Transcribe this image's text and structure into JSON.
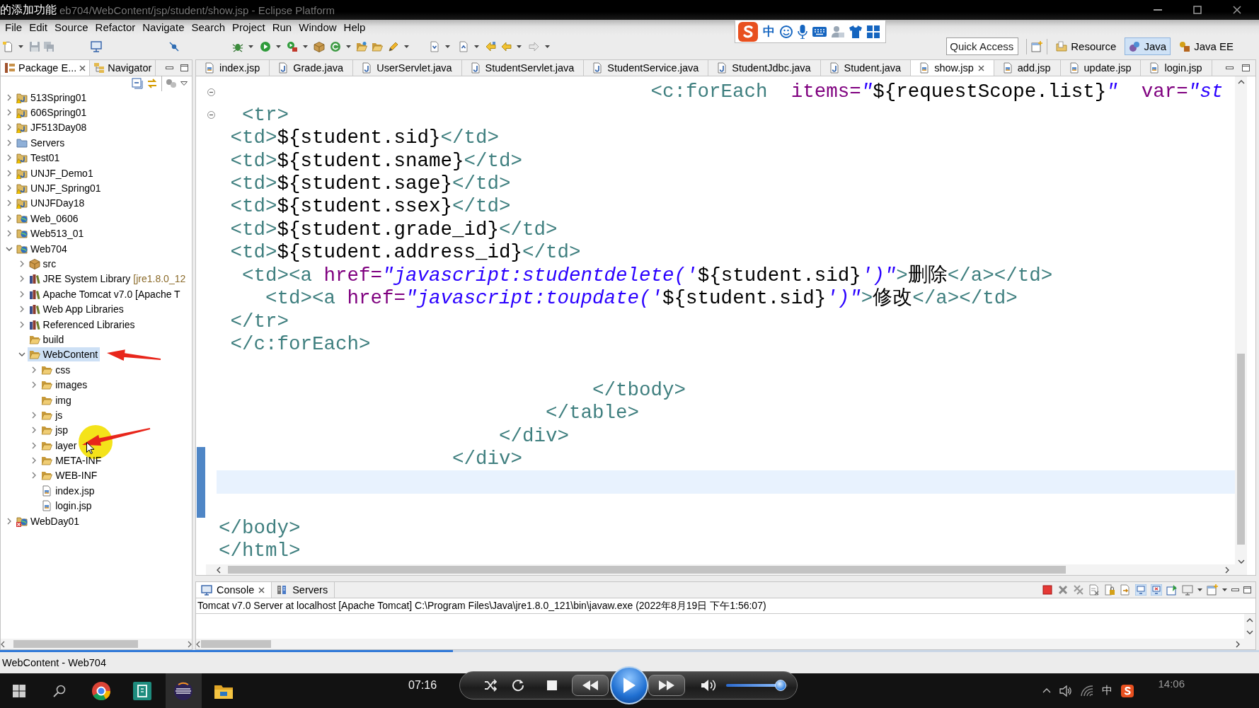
{
  "video_title": "的添加功能",
  "window": {
    "title": "eb704/WebContent/jsp/student/show.jsp - Eclipse Platform"
  },
  "menu": [
    "File",
    "Edit",
    "Source",
    "Refactor",
    "Navigate",
    "Search",
    "Project",
    "Run",
    "Window",
    "Help"
  ],
  "ime_toolbar": {
    "mode": "中"
  },
  "quick_access": {
    "placeholder": "Quick Access"
  },
  "perspectives": [
    {
      "label": "Resource",
      "kind": "resource",
      "selected": false
    },
    {
      "label": "Java",
      "kind": "java",
      "selected": true
    },
    {
      "label": "Java EE",
      "kind": "javaee",
      "selected": false
    }
  ],
  "package_explorer": {
    "tabs": [
      {
        "label": "Package E...",
        "kind": "packages",
        "selected": true
      },
      {
        "label": "Navigator",
        "kind": "navigator",
        "selected": false
      }
    ],
    "tree": [
      {
        "label": "513Spring01",
        "kind": "java-project",
        "warning": true,
        "error": false,
        "expanded": false,
        "selected": false
      },
      {
        "label": "606Spring01",
        "kind": "java-project",
        "warning": true,
        "error": false,
        "expanded": false,
        "selected": false
      },
      {
        "label": "JF513Day08",
        "kind": "java-project",
        "warning": true,
        "error": false,
        "expanded": false,
        "selected": false
      },
      {
        "label": "Servers",
        "kind": "project",
        "warning": false,
        "error": false,
        "expanded": false,
        "selected": false
      },
      {
        "label": "Test01",
        "kind": "java-project",
        "warning": true,
        "error": false,
        "expanded": false,
        "selected": false
      },
      {
        "label": "UNJF_Demo1",
        "kind": "java-project",
        "warning": true,
        "error": false,
        "expanded": false,
        "selected": false
      },
      {
        "label": "UNJF_Spring01",
        "kind": "java-project",
        "warning": true,
        "error": false,
        "expanded": false,
        "selected": false
      },
      {
        "label": "UNJFDay18",
        "kind": "java-project",
        "warning": true,
        "error": false,
        "expanded": false,
        "selected": false
      },
      {
        "label": "Web_0606",
        "kind": "web-project",
        "warning": false,
        "error": false,
        "expanded": false,
        "selected": false
      },
      {
        "label": "Web513_01",
        "kind": "web-project",
        "warning": false,
        "error": false,
        "expanded": false,
        "selected": false
      },
      {
        "label": "Web704",
        "kind": "web-project",
        "warning": false,
        "error": false,
        "expanded": true,
        "selected": false,
        "children": [
          {
            "label": "src",
            "kind": "source-folder",
            "expanded": false,
            "selected": false
          },
          {
            "label": "JRE System Library",
            "decoration": "[jre1.8.0_12",
            "kind": "library",
            "expanded": false,
            "selected": false
          },
          {
            "label": "Apache Tomcat v7.0 [Apache T",
            "kind": "library",
            "expanded": false,
            "selected": false
          },
          {
            "label": "Web App Libraries",
            "kind": "library",
            "expanded": false,
            "selected": false
          },
          {
            "label": "Referenced Libraries",
            "kind": "library",
            "expanded": false,
            "selected": false
          },
          {
            "label": "build",
            "kind": "folder",
            "selected": false
          },
          {
            "label": "WebContent",
            "kind": "folder",
            "expanded": true,
            "selected": true,
            "children": [
              {
                "label": "css",
                "kind": "folder",
                "expanded": false,
                "selected": false
              },
              {
                "label": "images",
                "kind": "folder",
                "expanded": false,
                "selected": false
              },
              {
                "label": "img",
                "kind": "folder",
                "selected": false
              },
              {
                "label": "js",
                "kind": "folder",
                "expanded": false,
                "selected": false
              },
              {
                "label": "jsp",
                "kind": "folder",
                "expanded": false,
                "selected": false
              },
              {
                "label": "layer",
                "kind": "folder",
                "expanded": false,
                "selected": false
              },
              {
                "label": "META-INF",
                "kind": "folder",
                "expanded": false,
                "selected": false
              },
              {
                "label": "WEB-INF",
                "kind": "folder",
                "expanded": false,
                "selected": false
              },
              {
                "label": "index.jsp",
                "kind": "jsp-file",
                "selected": false
              },
              {
                "label": "login.jsp",
                "kind": "jsp-file",
                "selected": false
              }
            ]
          }
        ]
      },
      {
        "label": "WebDay01",
        "kind": "web-project",
        "warning": false,
        "error": true,
        "expanded": false,
        "selected": false
      }
    ]
  },
  "editor": {
    "tabs": [
      {
        "label": "index.jsp",
        "kind": "jsp",
        "selected": false
      },
      {
        "label": "Grade.java",
        "kind": "java",
        "selected": false
      },
      {
        "label": "UserServlet.java",
        "kind": "java",
        "selected": false
      },
      {
        "label": "StudentServlet.java",
        "kind": "java",
        "selected": false
      },
      {
        "label": "StudentService.java",
        "kind": "java",
        "selected": false
      },
      {
        "label": "StudentJdbc.java",
        "kind": "java",
        "selected": false
      },
      {
        "label": "Student.java",
        "kind": "java",
        "selected": false
      },
      {
        "label": "show.jsp",
        "kind": "jsp",
        "selected": true
      },
      {
        "label": "add.jsp",
        "kind": "jsp",
        "selected": false
      },
      {
        "label": "update.jsp",
        "kind": "jsp",
        "selected": false
      },
      {
        "label": "login.jsp",
        "kind": "jsp",
        "selected": false
      }
    ],
    "lines": [
      {
        "fold": true,
        "current": false,
        "tokens": [
          {
            "kind": "tag",
            "text": "                                     <c:forEach  "
          },
          {
            "kind": "attr",
            "text": "items="
          },
          {
            "kind": "value",
            "text": "\""
          },
          {
            "kind": "el",
            "text": "${requestScope.list}"
          },
          {
            "kind": "value",
            "text": "\"  "
          },
          {
            "kind": "attr",
            "text": "var="
          },
          {
            "kind": "value",
            "text": "\"st"
          }
        ]
      },
      {
        "fold": true,
        "current": false,
        "tokens": [
          {
            "kind": "tag",
            "text": "  <tr>"
          }
        ]
      },
      {
        "fold": false,
        "current": false,
        "tokens": [
          {
            "kind": "tag",
            "text": " <td>"
          },
          {
            "kind": "el",
            "text": "${student.sid}"
          },
          {
            "kind": "tag",
            "text": "</td>"
          }
        ]
      },
      {
        "fold": false,
        "current": false,
        "tokens": [
          {
            "kind": "tag",
            "text": " <td>"
          },
          {
            "kind": "el",
            "text": "${student.sname}"
          },
          {
            "kind": "tag",
            "text": "</td>"
          }
        ]
      },
      {
        "fold": false,
        "current": false,
        "tokens": [
          {
            "kind": "tag",
            "text": " <td>"
          },
          {
            "kind": "el",
            "text": "${student.sage}"
          },
          {
            "kind": "tag",
            "text": "</td>"
          }
        ]
      },
      {
        "fold": false,
        "current": false,
        "tokens": [
          {
            "kind": "tag",
            "text": " <td>"
          },
          {
            "kind": "el",
            "text": "${student.ssex}"
          },
          {
            "kind": "tag",
            "text": "</td>"
          }
        ]
      },
      {
        "fold": false,
        "current": false,
        "tokens": [
          {
            "kind": "tag",
            "text": " <td>"
          },
          {
            "kind": "el",
            "text": "${student.grade_id}"
          },
          {
            "kind": "tag",
            "text": "</td>"
          }
        ]
      },
      {
        "fold": false,
        "current": false,
        "tokens": [
          {
            "kind": "tag",
            "text": " <td>"
          },
          {
            "kind": "el",
            "text": "${student.address_id}"
          },
          {
            "kind": "tag",
            "text": "</td>"
          }
        ]
      },
      {
        "fold": false,
        "current": false,
        "tokens": [
          {
            "kind": "tag",
            "text": "  <td><a "
          },
          {
            "kind": "attr",
            "text": "href="
          },
          {
            "kind": "value",
            "text": "\"javascript:studentdelete('"
          },
          {
            "kind": "el",
            "text": "${student.sid}"
          },
          {
            "kind": "value",
            "text": "')\""
          },
          {
            "kind": "tag",
            "text": ">"
          },
          {
            "kind": "text",
            "text": "删除"
          },
          {
            "kind": "tag",
            "text": "</a></td>"
          }
        ]
      },
      {
        "fold": false,
        "current": false,
        "tokens": [
          {
            "kind": "tag",
            "text": "    <td><a "
          },
          {
            "kind": "attr",
            "text": "href="
          },
          {
            "kind": "value",
            "text": "\"javascript:toupdate('"
          },
          {
            "kind": "el",
            "text": "${student.sid}"
          },
          {
            "kind": "value",
            "text": "')\""
          },
          {
            "kind": "tag",
            "text": ">"
          },
          {
            "kind": "text",
            "text": "修改"
          },
          {
            "kind": "tag",
            "text": "</a></td>"
          }
        ]
      },
      {
        "fold": false,
        "current": false,
        "tokens": [
          {
            "kind": "tag",
            "text": " </tr>"
          }
        ]
      },
      {
        "fold": false,
        "current": false,
        "tokens": [
          {
            "kind": "tag",
            "text": " </c:forEach>"
          }
        ]
      },
      {
        "fold": false,
        "current": false
      },
      {
        "fold": false,
        "current": false,
        "tokens": [
          {
            "kind": "tag",
            "text": "                                </tbody>"
          }
        ]
      },
      {
        "fold": false,
        "current": false,
        "tokens": [
          {
            "kind": "tag",
            "text": "                            </table>"
          }
        ]
      },
      {
        "fold": false,
        "current": false,
        "tokens": [
          {
            "kind": "tag",
            "text": "                        </div>"
          }
        ]
      },
      {
        "fold": false,
        "current": false,
        "tokens": [
          {
            "kind": "tag",
            "text": "                    </div>"
          }
        ]
      },
      {
        "fold": false,
        "current": true
      },
      {
        "fold": false,
        "current": false
      },
      {
        "fold": false,
        "current": false,
        "tokens": [
          {
            "kind": "tag",
            "text": "</body>"
          }
        ]
      },
      {
        "fold": false,
        "current": false,
        "tokens": [
          {
            "kind": "tag",
            "text": "</html>"
          }
        ]
      }
    ]
  },
  "console": {
    "tabs": [
      {
        "label": "Console",
        "kind": "console",
        "selected": true
      },
      {
        "label": "Servers",
        "kind": "servers",
        "selected": false
      }
    ],
    "header": "Tomcat v7.0 Server at localhost [Apache Tomcat] C:\\Program Files\\Java\\jre1.8.0_121\\bin\\javaw.exe (2022年8月19日 下午1:56:07)"
  },
  "status_bar": {
    "text": "WebContent - Web704"
  },
  "taskbar": {
    "player": {
      "time": "07:16",
      "progress": {
        "level": 0.36
      },
      "volume": {
        "level": 0.89
      }
    },
    "tray": {
      "ime": "中",
      "clock": "14:06"
    }
  }
}
